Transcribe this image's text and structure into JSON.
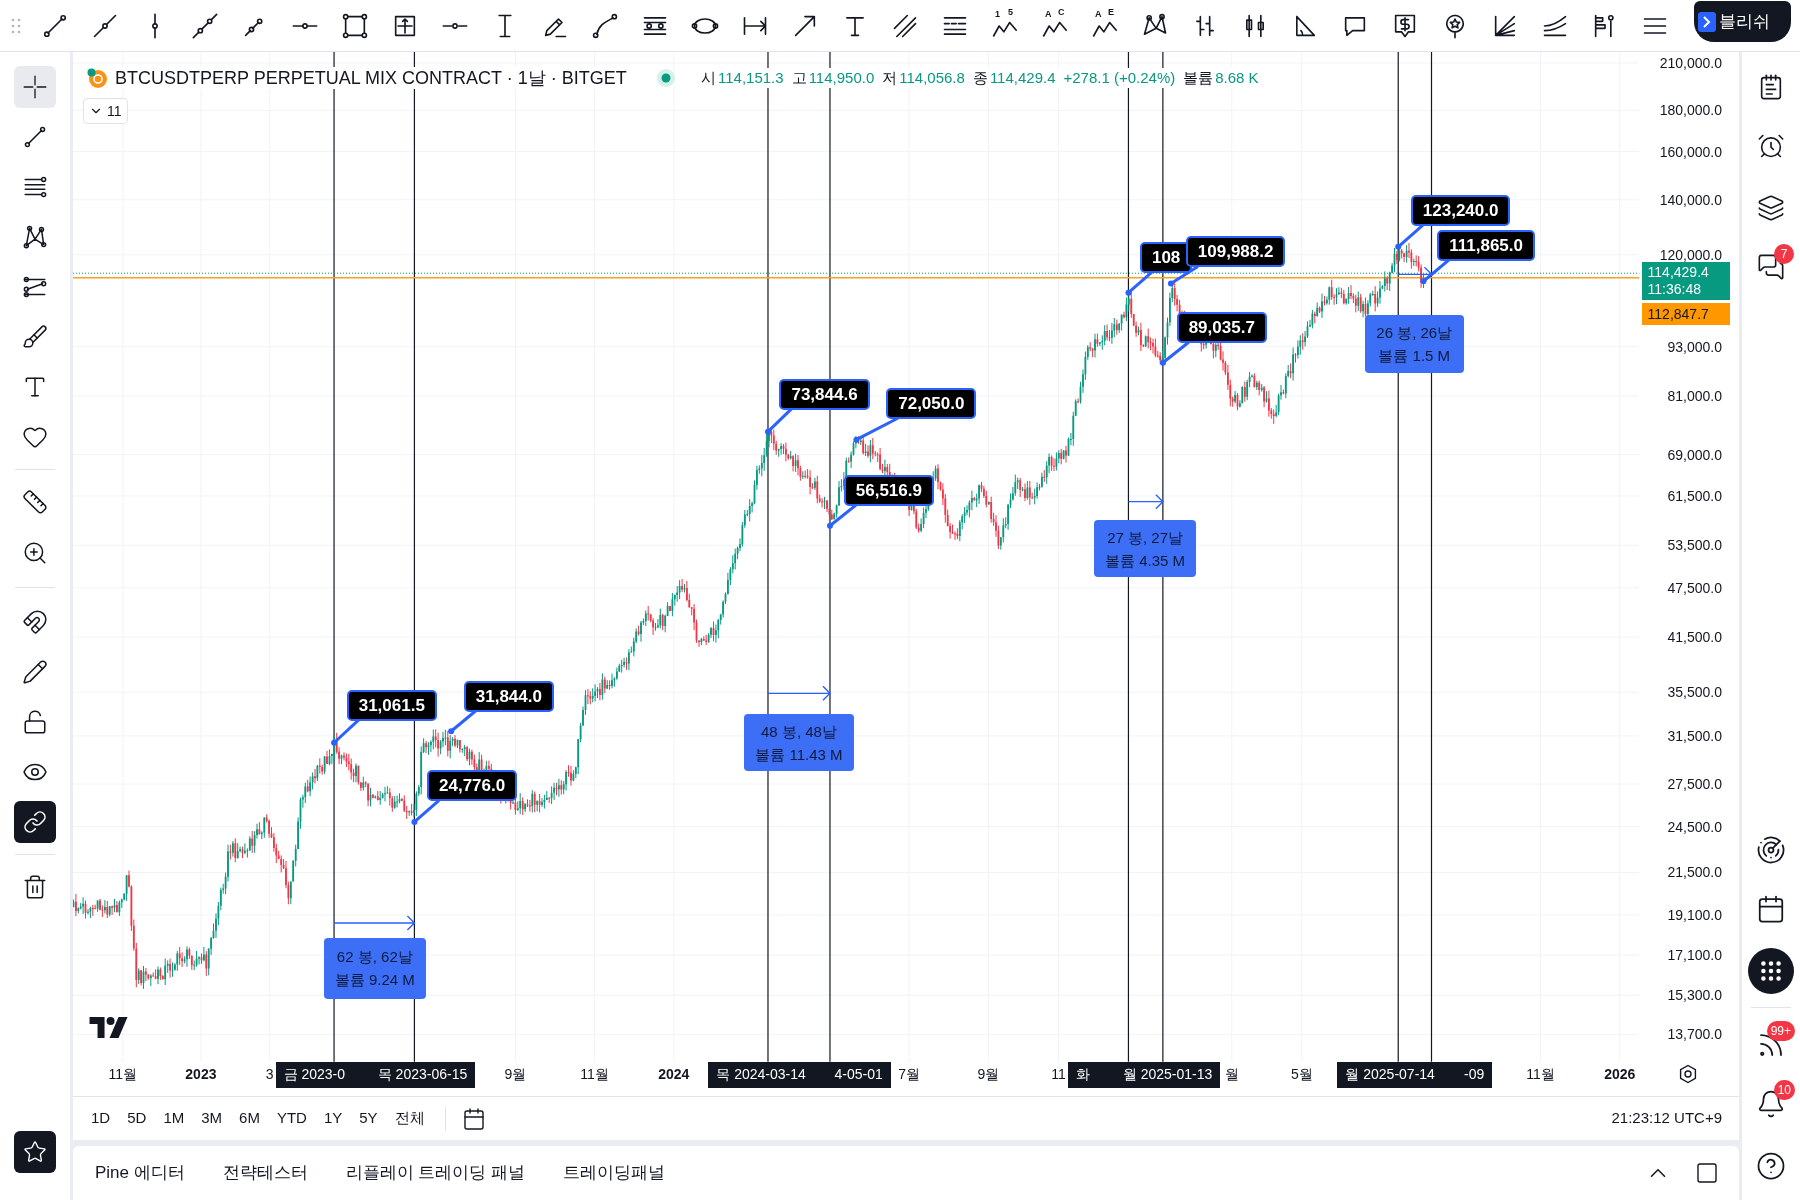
{
  "top_toolbar": {
    "wave_tools": [
      {
        "marks": [
          "1",
          "5"
        ]
      },
      {
        "marks": [
          "A",
          "C"
        ]
      },
      {
        "marks": [
          "A",
          "E"
        ]
      }
    ],
    "publish_button": "블리쉬"
  },
  "left_toolbar": {
    "drawing_tools": [
      {
        "selected": true
      },
      {
        "selected": false
      },
      {
        "selected": false
      },
      {
        "selected": false
      },
      {
        "selected": false
      },
      {
        "selected": false
      },
      {
        "selected": false
      },
      {
        "selected": false
      }
    ],
    "measure_tools": [
      {
        "selected": false
      },
      {
        "selected": false
      }
    ],
    "toggles": [
      {
        "on": false
      },
      {
        "on": false
      },
      {
        "on": false
      },
      {
        "on": false
      },
      {
        "on": true
      }
    ],
    "favorites_toggle": {
      "on": true
    }
  },
  "chart": {
    "header": {
      "symbol": "BTCUSDTPERP PERPETUAL MIX CONTRACT · 1날 · BITGET",
      "ohlc": [
        {
          "label": "시",
          "value": "114,151.3"
        },
        {
          "label": "고",
          "value": "114,950.0"
        },
        {
          "label": "저",
          "value": "114,056.8"
        },
        {
          "label": "종",
          "value": "114,429.4"
        }
      ],
      "change": "+278.1 (+0.24%)",
      "volume": {
        "label": "볼륨",
        "value": "8.68 K"
      }
    },
    "indicators_count": "11",
    "price_axis": {
      "labels": [
        "210,000.0",
        "180,000.0",
        "160,000.0",
        "140,000.0",
        "120,000.0",
        "93,000.0",
        "81,000.0",
        "69,000.0",
        "61,500.0",
        "53,500.0",
        "47,500.0",
        "41,500.0",
        "35,500.0",
        "31,500.0",
        "27,500.0",
        "24,500.0",
        "21,500.0",
        "19,100.0",
        "17,100.0",
        "15,300.0",
        "13,700.0"
      ],
      "current_price": "114,429.4",
      "countdown": "11:36:48",
      "line_price": "112,847.7"
    },
    "time_axis": {
      "labels": [
        {
          "text": "11월",
          "kind": "month"
        },
        {
          "text": "2023",
          "kind": "year"
        },
        {
          "text": "3",
          "kind": "month"
        },
        {
          "text": "9월",
          "kind": "month"
        },
        {
          "text": "11월",
          "kind": "month"
        },
        {
          "text": "2024",
          "kind": "year"
        },
        {
          "text": "7월",
          "kind": "month"
        },
        {
          "text": "9월",
          "kind": "month"
        },
        {
          "text": "11",
          "kind": "month"
        },
        {
          "text": "월",
          "kind": "month"
        },
        {
          "text": "5월",
          "kind": "month"
        },
        {
          "text": "11월",
          "kind": "month"
        },
        {
          "text": "2026",
          "kind": "year"
        }
      ],
      "date_markers": [
        {
          "texts": [
            "금 2023-0",
            "목 2023-06-15"
          ]
        },
        {
          "texts": [
            "목 2024-03-14",
            "4-05-01"
          ]
        },
        {
          "texts": [
            "화",
            "월 2025-01-13"
          ]
        },
        {
          "texts": [
            "월 2025-07-14",
            "-09"
          ]
        }
      ]
    },
    "price_callouts": [
      "31,061.5",
      "31,844.0",
      "24,776.0",
      "73,844.6",
      "72,050.0",
      "56,516.9",
      "108",
      "109,988.2",
      "89,035.7",
      "123,240.0",
      "111,865.0"
    ],
    "date_ranges": [
      {
        "bars": "62 봉, 62날",
        "volume": "볼륨 9.24 M"
      },
      {
        "bars": "48 봉, 48날",
        "volume": "볼륨 11.43 M"
      },
      {
        "bars": "27 봉, 27날",
        "volume": "볼륨 4.35 M"
      },
      {
        "bars": "26 봉, 26날",
        "volume": "볼륨 1.5 M"
      }
    ]
  },
  "right_sidebar": {
    "chat_badge": "7",
    "feed_badge": "99+",
    "alert_badge": "10"
  },
  "period_bar": {
    "periods": [
      {
        "label": "1D",
        "selected": false
      },
      {
        "label": "5D",
        "selected": false
      },
      {
        "label": "1M",
        "selected": false
      },
      {
        "label": "3M",
        "selected": false
      },
      {
        "label": "6M",
        "selected": false
      },
      {
        "label": "YTD",
        "selected": false
      },
      {
        "label": "1Y",
        "selected": false
      },
      {
        "label": "5Y",
        "selected": false
      },
      {
        "label": "전체",
        "selected": false
      }
    ],
    "clock": "21:23:12 UTC+9"
  },
  "bottom_panel": {
    "tabs": [
      {
        "label": "Pine 에디터",
        "selected": false
      },
      {
        "label": "전략테스터",
        "selected": false
      },
      {
        "label": "리플레이 트레이딩 패널",
        "selected": false
      },
      {
        "label": "트레이딩패널",
        "selected": false
      }
    ]
  }
}
